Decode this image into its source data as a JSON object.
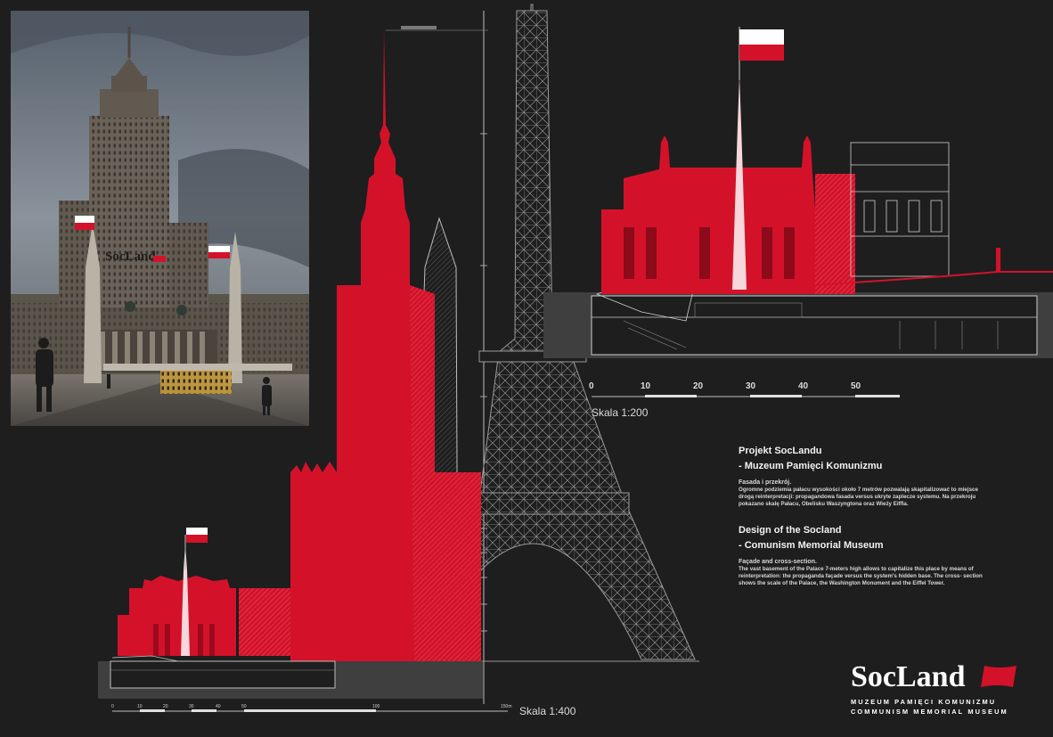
{
  "photo": {
    "sign_text": "SocLand",
    "flag_colors": {
      "white": "#ffffff",
      "red": "#dc143c"
    }
  },
  "elevation_200": {
    "scale_label": "Skala 1:200",
    "scale_ticks": [
      "0",
      "10",
      "20",
      "30",
      "40",
      "50"
    ]
  },
  "elevation_400": {
    "scale_label": "Skala 1:400",
    "scale_ticks": [
      "0",
      "10",
      "20",
      "30",
      "40",
      "50",
      "100",
      "150m"
    ]
  },
  "text_pl": {
    "title_line1": "Projekt SocLandu",
    "title_line2": "- Muzeum Pamięci Komunizmu",
    "subtitle": "Fasada i przekrój.",
    "body_line1": "Ogromne podziemia pałacu wysokości około 7 metrów pozwalają skapitalizować to miejsce",
    "body_line2": "drogą reinterpretacji: propagandowa fasada versus ukryte zaplecze systemu. Na przekroju",
    "body_line3": "pokazano skalę Pałacu, Obelisku Waszyngtona oraz Wieży Eiffla."
  },
  "text_en": {
    "title_line1": "Design of the Socland",
    "title_line2": "- Comunism Memorial Museum",
    "subtitle": "Façade and cross-section.",
    "body_line1": "The vast basement of the Palace 7-meters high allows to capitalize this place by means of",
    "body_line2": "reinterpretation: the propaganda façade versus the system's hidden base. The cross- section",
    "body_line3": "shows the scale of the Palace, the Washington Monument and the Eiffel Tower."
  },
  "logo": {
    "wordmark": "SocLand",
    "line1": "MUZEUM PAMIĘCI KOMUNIZMU",
    "line2": "COMMUNISM MEMORIAL MUSEUM"
  },
  "colors": {
    "background": "#1e1e1f",
    "accent_red": "#d3122a",
    "line_white": "#cfcfcf"
  }
}
